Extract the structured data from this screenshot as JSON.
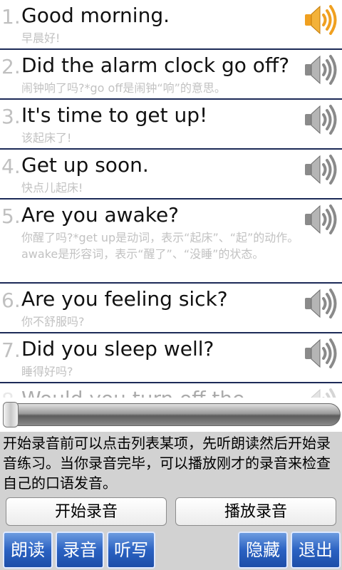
{
  "phrases": [
    {
      "num": "1.",
      "en": "Good morning.",
      "zh": "早晨好!",
      "playing": true
    },
    {
      "num": "2.",
      "en": "Did the alarm clock go off?",
      "zh": "闹钟响了吗?*go off是闹钟“响”的意思。",
      "playing": false
    },
    {
      "num": "3.",
      "en": "It's time to get up!",
      "zh": "该起床了!",
      "playing": false
    },
    {
      "num": "4.",
      "en": "Get up soon.",
      "zh": "快点儿起床!",
      "playing": false
    },
    {
      "num": "5.",
      "en": "Are you awake?",
      "zh": "你醒了吗?*get up是动词，表示“起床”、“起”的动作。awake是形容词，表示“醒了”、“没睡”的状态。",
      "playing": false
    },
    {
      "num": "6.",
      "en": "Are you feeling sick?",
      "zh": "你不舒服吗?",
      "playing": false
    },
    {
      "num": "7.",
      "en": "Did you sleep well?",
      "zh": "睡得好吗?",
      "playing": false
    },
    {
      "num": "8.",
      "en": "Would you turn off the",
      "zh": "",
      "playing": false
    }
  ],
  "playback": {
    "progress": 0.0
  },
  "instructions": "开始录音前可以点击列表某项，先听朗读然后开始录音练习。当你录音完毕，可以播放刚才的录音来检查自己的口语发音。",
  "buttons": {
    "start_record": "开始录音",
    "play_record": "播放录音",
    "read": "朗读",
    "record": "录音",
    "dictation": "听写",
    "hide": "隐藏",
    "exit": "退出"
  },
  "colors": {
    "speaker_active": "#f0a020",
    "speaker_inactive": "#8a8a8a",
    "divider": "#1c2a57",
    "button_blue": "#2b62c2"
  }
}
